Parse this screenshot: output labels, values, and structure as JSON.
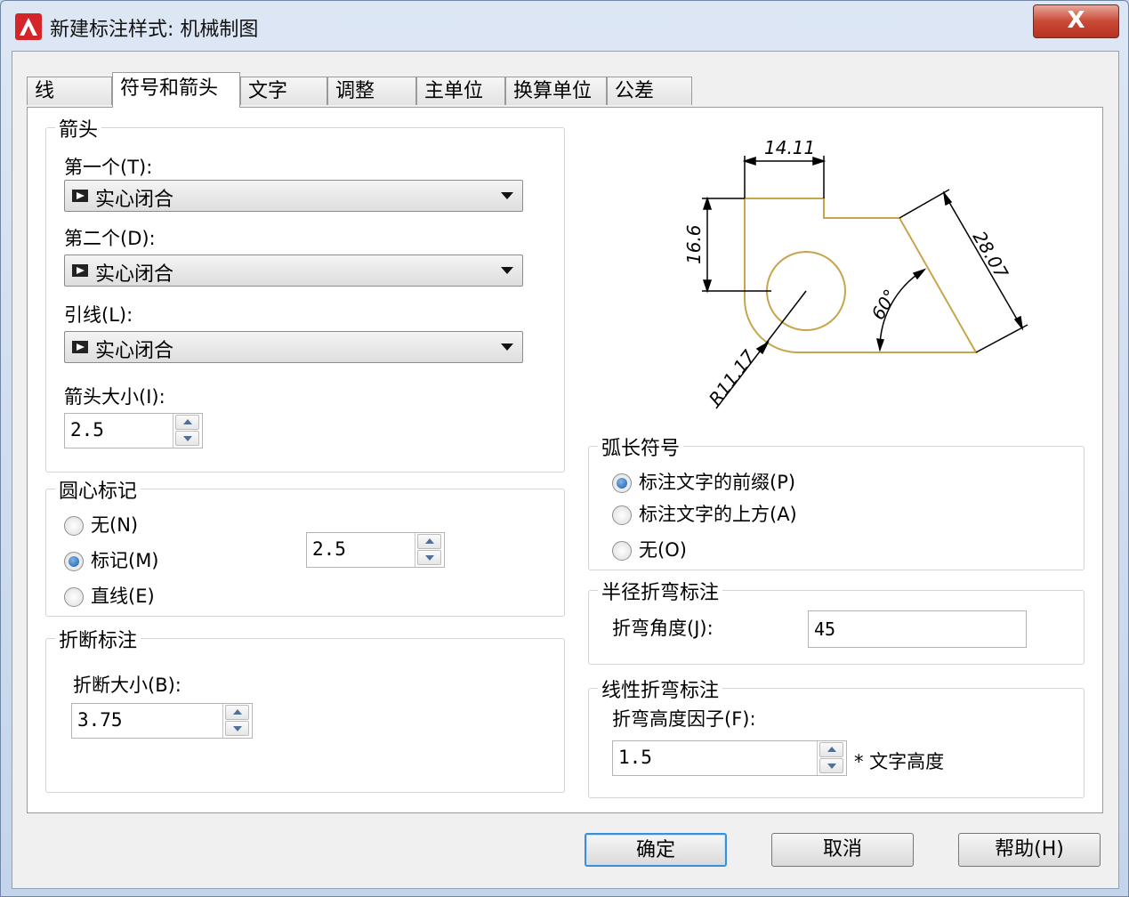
{
  "window": {
    "title": "新建标注样式: 机械制图",
    "close_label": "X"
  },
  "tabs": [
    {
      "label": "线"
    },
    {
      "label": "符号和箭头"
    },
    {
      "label": "文字"
    },
    {
      "label": "调整"
    },
    {
      "label": "主单位"
    },
    {
      "label": "换算单位"
    },
    {
      "label": "公差"
    }
  ],
  "arrows": {
    "title": "箭头",
    "first_label": "第一个(T):",
    "first_value": "实心闭合",
    "second_label": "第二个(D):",
    "second_value": "实心闭合",
    "leader_label": "引线(L):",
    "leader_value": "实心闭合",
    "size_label": "箭头大小(I):",
    "size_value": "2.5"
  },
  "center_marks": {
    "title": "圆心标记",
    "none_label": "无(N)",
    "mark_label": "标记(M)",
    "line_label": "直线(E)",
    "size_value": "2.5",
    "selected": "mark"
  },
  "break": {
    "title": "折断标注",
    "size_label": "折断大小(B):",
    "size_value": "3.75"
  },
  "arc_length": {
    "title": "弧长符号",
    "prefix_label": "标注文字的前缀(P)",
    "above_label": "标注文字的上方(A)",
    "none_label": "无(O)",
    "selected": "prefix"
  },
  "radius_jog": {
    "title": "半径折弯标注",
    "angle_label": "折弯角度(J):",
    "angle_value": "45"
  },
  "linear_jog": {
    "title": "线性折弯标注",
    "factor_label": "折弯高度因子(F):",
    "factor_value": "1.5",
    "unit_label": "* 文字高度"
  },
  "preview": {
    "dim_top": "14.11",
    "dim_left": "16.6",
    "dim_slant": "28.07",
    "dim_angle": "60°",
    "dim_radius": "R11.17",
    "line_color": "#c8a54a"
  },
  "buttons": {
    "ok": "确定",
    "cancel": "取消",
    "help": "帮助(H)"
  },
  "colors": {
    "title_bar": "#c4d4ea",
    "close": "#c94a37",
    "radio_active": "#1d5aa8"
  },
  "icons": [
    "autocad-app-icon",
    "solid-closed-arrow-icon",
    "chevron-down-icon",
    "spin-up-icon",
    "spin-down-icon"
  ]
}
